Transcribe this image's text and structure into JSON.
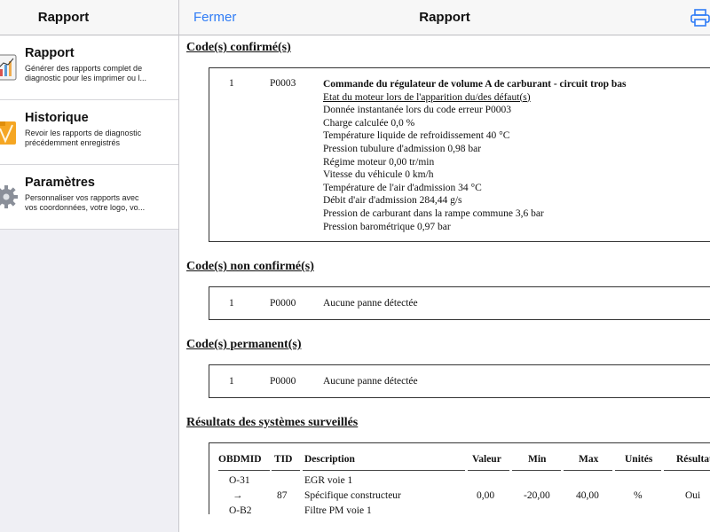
{
  "sidebar": {
    "title": "Rapport",
    "items": [
      {
        "title": "Rapport",
        "desc": "Générer des rapports complet de\ndiagnostic pour les imprimer ou l...",
        "icon": "report-chart-icon"
      },
      {
        "title": "Historique",
        "desc": "Revoir les rapports de diagnostic\nprécédemment enregistrés",
        "icon": "folder-icon"
      },
      {
        "title": "Paramètres",
        "desc": "Personnaliser vos rapports avec\nvos coordonnées, votre logo, vo...",
        "icon": "gear-icon"
      }
    ]
  },
  "header": {
    "close_label": "Fermer",
    "title": "Rapport",
    "print_icon": "printer-icon"
  },
  "colors": {
    "accent": "#2f7cf6",
    "sidebar_bg": "#efeff4"
  },
  "report": {
    "confirmed": {
      "heading": "Code(s) confirmé(s)",
      "num": "1",
      "code": "P0003",
      "lines": [
        "Commande du régulateur de volume A de carburant - circuit trop bas",
        "Etat du moteur lors de l'apparition du/des défaut(s)",
        "Donnée instantanée lors du code erreur P0003",
        "Charge calculée 0,0 %",
        "Température liquide de refroidissement 40 °C",
        "Pression tubulure d'admission 0,98 bar",
        "Régime moteur 0,00 tr/min",
        "Vitesse du véhicule 0 km/h",
        "Température de l'air d'admission 34 °C",
        "Débit d'air d'admission 284,44 g/s",
        "Pression de carburant dans la rampe commune 3,6 bar",
        "Pression barométrique 0,97 bar"
      ]
    },
    "unconfirmed": {
      "heading": "Code(s) non confirmé(s)",
      "num": "1",
      "code": "P0000",
      "text": "Aucune panne détectée"
    },
    "permanent": {
      "heading": "Code(s) permanent(s)",
      "num": "1",
      "code": "P0000",
      "text": "Aucune panne détectée"
    },
    "results": {
      "heading": "Résultats des systèmes surveillés",
      "columns": [
        "OBDMID",
        "TID",
        "Description",
        "Valeur",
        "Min",
        "Max",
        "Unités",
        "Résultat"
      ],
      "rows": [
        {
          "obdmid": "O-31",
          "description": "EGR voie 1"
        },
        {
          "obdmid": "→",
          "tid": "87",
          "description": "Spécifique constructeur",
          "valeur": "0,00",
          "min": "-20,00",
          "max": "40,00",
          "unites": "%",
          "resultat": "Oui"
        },
        {
          "obdmid": "O-B2",
          "description": "Filtre PM voie 1"
        }
      ]
    }
  }
}
